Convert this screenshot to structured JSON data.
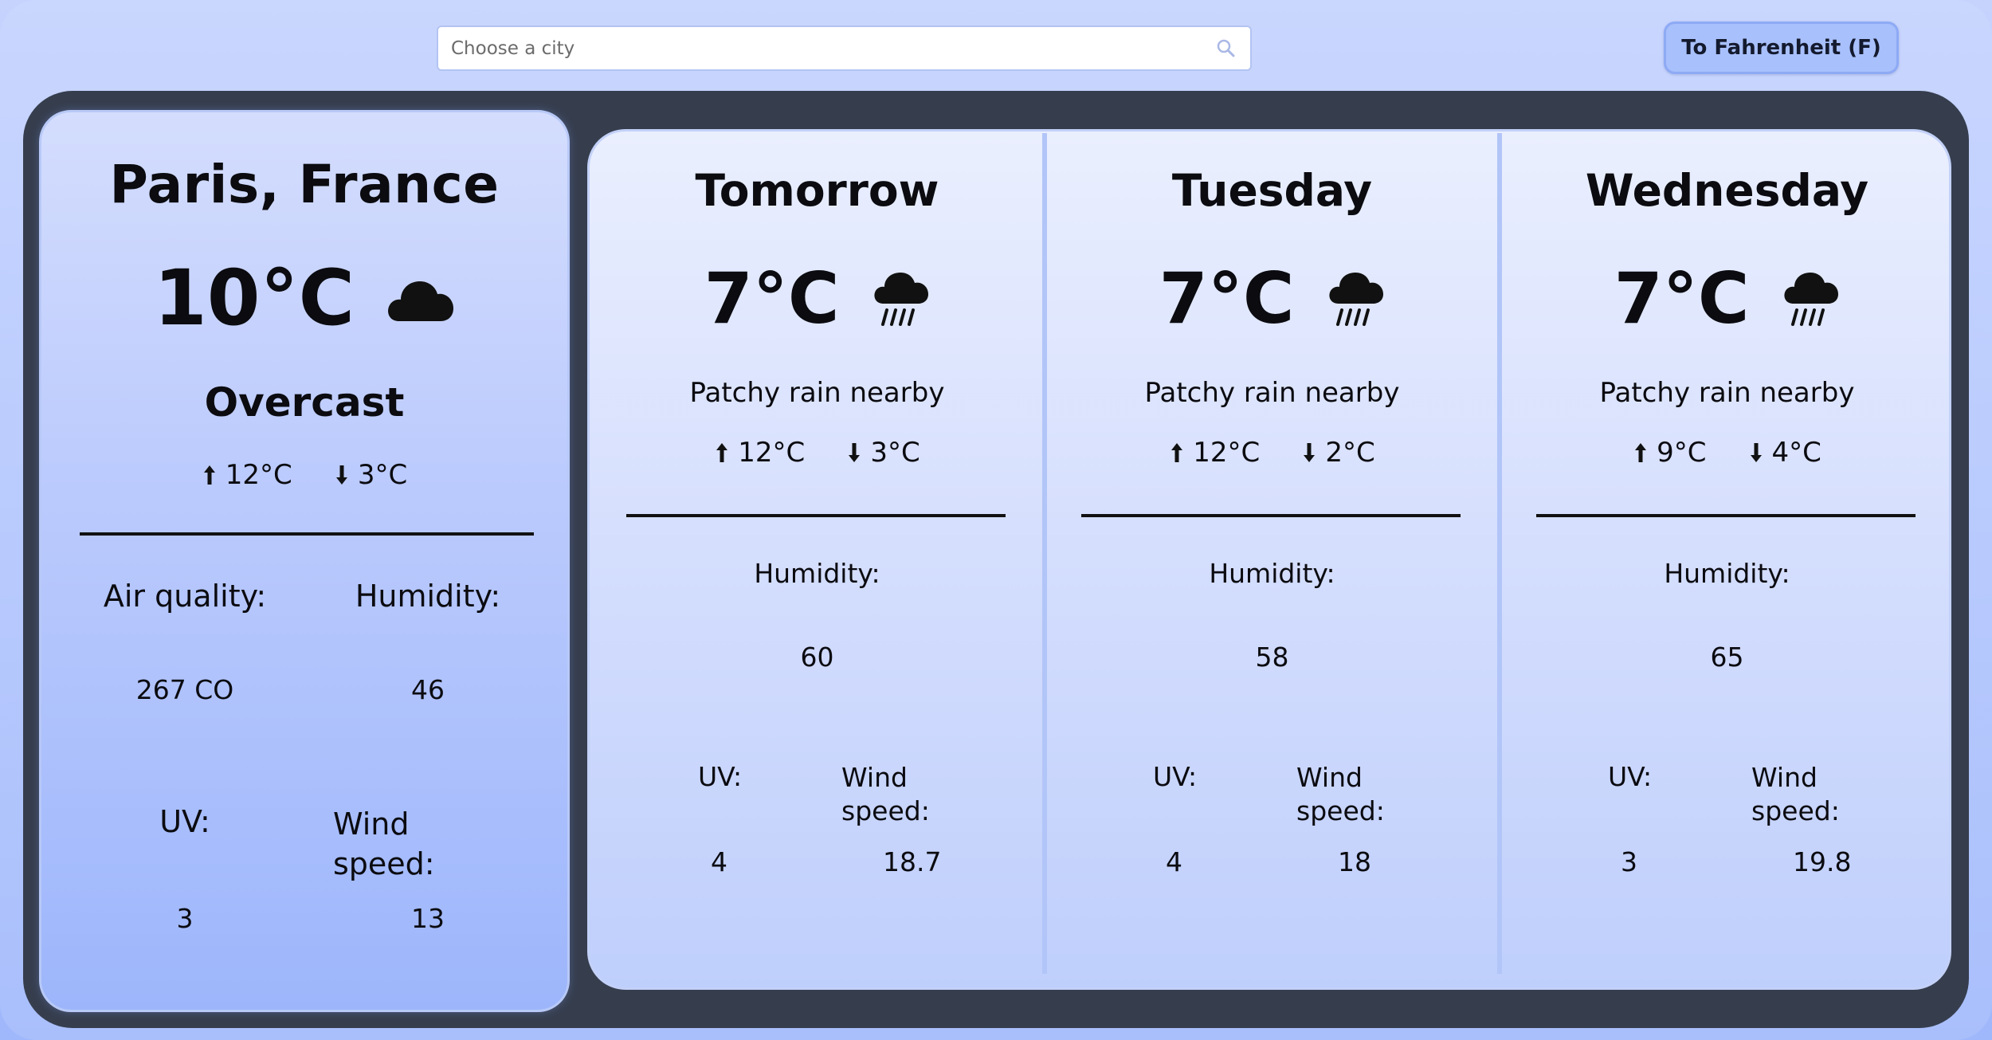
{
  "search": {
    "placeholder": "Choose a city"
  },
  "unit_toggle": {
    "label": "To Fahrenheit (F)"
  },
  "current": {
    "city": "Paris, France",
    "temp": "10°C",
    "icon": "cloud-icon",
    "condition": "Overcast",
    "high": "12°C",
    "low": "3°C",
    "air_quality_label": "Air quality:",
    "air_quality_value": "267 CO",
    "humidity_label": "Humidity:",
    "humidity_value": "46",
    "uv_label": "UV:",
    "uv_value": "3",
    "wind_label": "Wind speed:",
    "wind_value": "13"
  },
  "forecast": [
    {
      "day": "Tomorrow",
      "temp": "7°C",
      "icon": "rain-cloud-icon",
      "condition": "Patchy rain nearby",
      "high": "12°C",
      "low": "3°C",
      "humidity_label": "Humidity:",
      "humidity": "60",
      "uv_label": "UV:",
      "uv": "4",
      "wind_label": "Wind speed:",
      "wind": "18.7"
    },
    {
      "day": "Tuesday",
      "temp": "7°C",
      "icon": "rain-cloud-icon",
      "condition": "Patchy rain nearby",
      "high": "12°C",
      "low": "2°C",
      "humidity_label": "Humidity:",
      "humidity": "58",
      "uv_label": "UV:",
      "uv": "4",
      "wind_label": "Wind speed:",
      "wind": "18"
    },
    {
      "day": "Wednesday",
      "temp": "7°C",
      "icon": "rain-cloud-icon",
      "condition": "Patchy rain nearby",
      "high": "9°C",
      "low": "4°C",
      "humidity_label": "Humidity:",
      "humidity": "65",
      "uv_label": "UV:",
      "uv": "3",
      "wind_label": "Wind speed:",
      "wind": "19.8"
    }
  ]
}
